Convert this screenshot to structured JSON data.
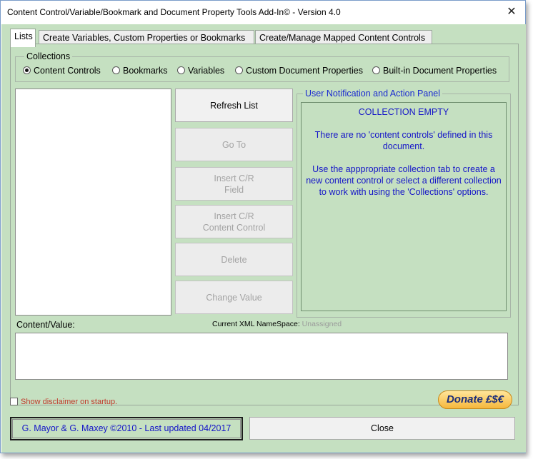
{
  "window": {
    "title": "Content Control/Variable/Bookmark and Document Property Tools Add-In© - Version 4.0",
    "close_glyph": "✕"
  },
  "tabs": [
    {
      "label": "Lists"
    },
    {
      "label": "Create Variables, Custom Properties or Bookmarks"
    },
    {
      "label": "Create/Manage Mapped Content Controls"
    }
  ],
  "collections": {
    "legend": "Collections",
    "options": [
      {
        "label": "Content Controls",
        "checked": true
      },
      {
        "label": "Bookmarks",
        "checked": false
      },
      {
        "label": "Variables",
        "checked": false
      },
      {
        "label": "Custom Document Properties",
        "checked": false
      },
      {
        "label": "Built-in Document Properties",
        "checked": false
      }
    ]
  },
  "buttons": {
    "refresh": "Refresh List",
    "goto": "Go To",
    "insert_field_line1": "Insert C/R",
    "insert_field_line2": "Field",
    "insert_cc_line1": "Insert C/R",
    "insert_cc_line2": "Content Control",
    "delete": "Delete",
    "change_value": "Change Value"
  },
  "notification": {
    "legend": "User Notification and Action Panel",
    "heading": "COLLECTION EMPTY",
    "message1": "There are no 'content controls' defined in this document.",
    "message2": "Use the apppropriate collection tab to create a new content control or select a different collection to work with using the 'Collections' options."
  },
  "content_value": {
    "label": "Content/Value:",
    "xml_label": "Current XML NameSpace:",
    "xml_value": "Unassigned"
  },
  "footer": {
    "disclaimer": "Show disclaimer on startup.",
    "donate": "Donate £$€",
    "credit": "G. Mayor & G. Maxey ©2010 - Last updated 04/2017",
    "close": "Close"
  },
  "colors": {
    "panel_background": "#c5e0c1",
    "notification_text": "#1515c8",
    "disclaimer_text": "#c0392b"
  }
}
